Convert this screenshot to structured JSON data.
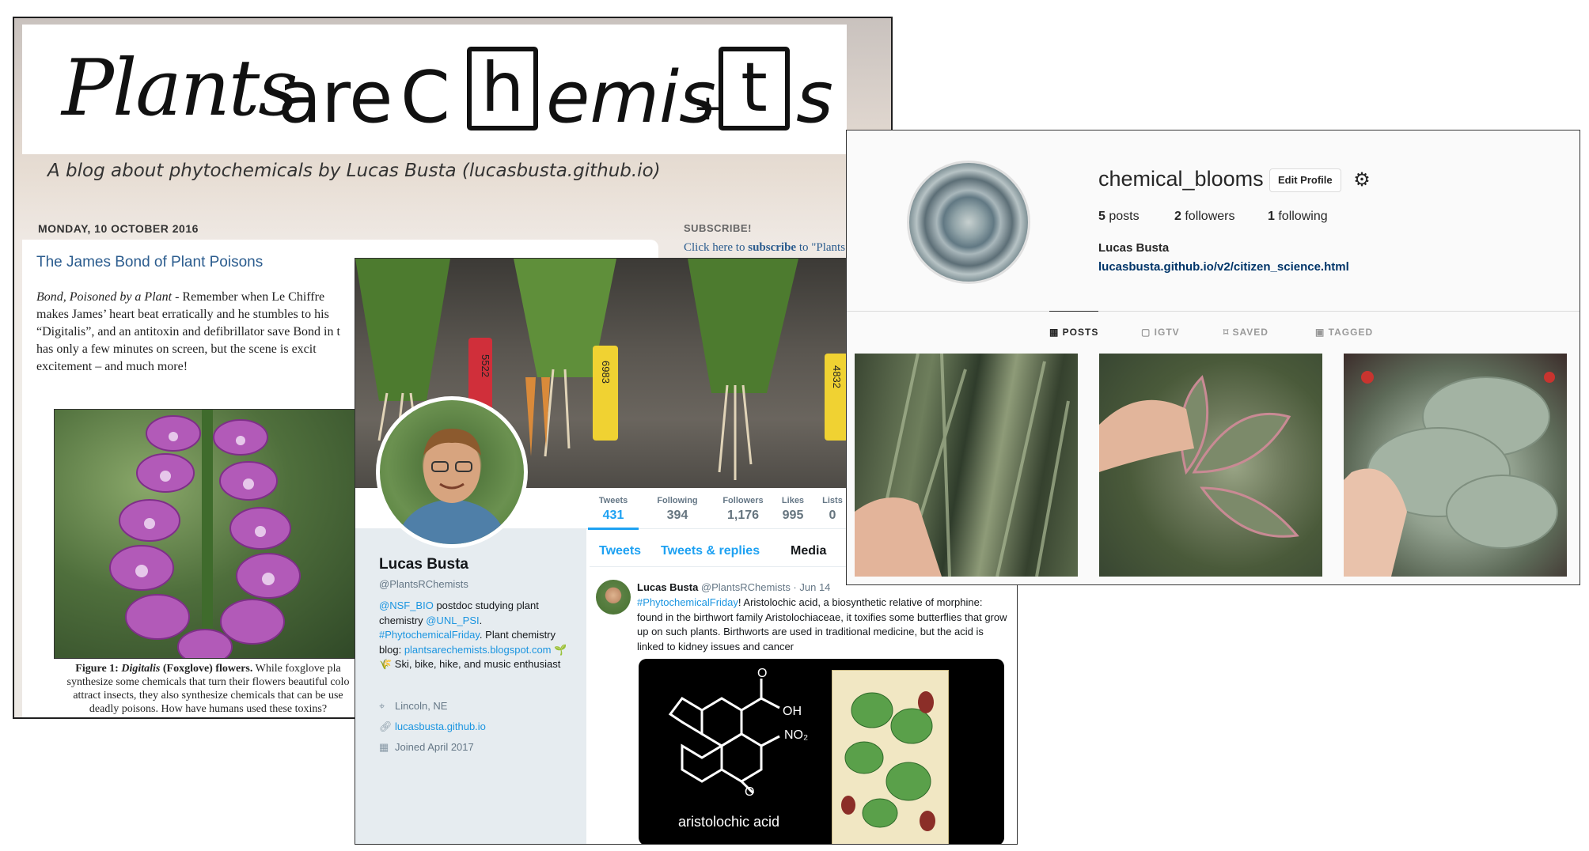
{
  "blog": {
    "masthead": {
      "plants": "Plants",
      "are": "are",
      "c": "C",
      "h": "h",
      "emis": "emis",
      "plus": "+",
      "t": "t",
      "s": "s"
    },
    "tagline": "A blog about phytochemicals by Lucas Busta (lucasbusta.github.io)",
    "date": "MONDAY, 10 OCTOBER 2016",
    "post_title": "The James Bond of Plant Poisons",
    "post_lead": "Bond, Poisoned by a Plant",
    "post_body_lines": [
      " - Remember when Le Chiffre",
      "makes James’ heart beat erratically and he stumbles to his",
      "“Digitalis”, and an antitoxin and defibrillator save Bond in t",
      "has only a few minutes on screen, but the scene is excit",
      "excitement – and much more!"
    ],
    "figure_caption_label": "Figure 1: ",
    "figure_caption_italic": "Digitalis",
    "figure_caption_bold": " (Foxglove) flowers.",
    "figure_caption_lines": [
      " While foxglove pla",
      "synthesize some chemicals that turn their flowers beautiful colo",
      "attract insects, they also synthesize chemicals that can be use",
      "deadly poisons. How have humans used these toxins?"
    ],
    "subscribe_heading": "SUBSCRIBE!",
    "subscribe_link_pre": "Click here to ",
    "subscribe_link_bold": "subscribe",
    "subscribe_link_post": " to \"Plants"
  },
  "twitter": {
    "stats": [
      {
        "label": "Tweets",
        "value": "431"
      },
      {
        "label": "Following",
        "value": "394"
      },
      {
        "label": "Followers",
        "value": "1,176"
      },
      {
        "label": "Likes",
        "value": "995"
      },
      {
        "label": "Lists",
        "value": "0"
      }
    ],
    "name": "Lucas Busta",
    "handle": "@PlantsRChemists",
    "bio": {
      "mention1": "@NSF_BIO",
      "text1": " postdoc studying plant chemistry ",
      "mention2": "@UNL_PSI",
      "text2": ". ",
      "hashtag": "#PhytochemicalFriday",
      "text3": ". Plant chemistry blog: ",
      "blog_link": "plantsarechemists.blogspot.com",
      "text4": " 🌱🌾 Ski, bike, hike, and music enthusiast"
    },
    "location": "Lincoln, NE",
    "website": "lucasbusta.github.io",
    "joined": "Joined April 2017",
    "tabs": {
      "tweets": "Tweets",
      "replies": "Tweets & replies",
      "media": "Media"
    },
    "tweet": {
      "name": "Lucas Busta",
      "handle_date": " @PlantsRChemists · Jun 14",
      "hashtag": "#PhytochemicalFriday",
      "text": "! Aristolochic acid, a biosynthetic relative of morphine: found in the birthwort family Aristolochiaceae, it toxifies some butterflies that grow up on such plants. Birthworts are used in traditional medicine, but the acid is linked to kidney issues and cancer",
      "media_caption": "aristolochic acid",
      "chem_labels": {
        "o": "O",
        "oh": "OH",
        "no2": "NO₂",
        "o_bottom": "O"
      }
    },
    "stakes": [
      "5522",
      "6983",
      "4832"
    ]
  },
  "instagram": {
    "username": "chemical_blooms",
    "edit_profile": "Edit Profile",
    "posts_count": "5",
    "posts_label": " posts",
    "followers_count": "2",
    "followers_label": " followers",
    "following_count": "1",
    "following_label": " following",
    "full_name": "Lucas Busta",
    "link": "lucasbusta.github.io/v2/citizen_science.html",
    "tabs": {
      "posts": "POSTS",
      "igtv": "IGTV",
      "saved": "SAVED",
      "tagged": "TAGGED"
    }
  },
  "icons": {
    "location": "map-pin-icon",
    "website": "link-icon",
    "joined": "calendar-icon",
    "settings": "gear-icon"
  },
  "colors": {
    "twitter_blue": "#1da1f2",
    "blog_link_blue": "#2b5c8e",
    "instagram_link": "#003569"
  }
}
